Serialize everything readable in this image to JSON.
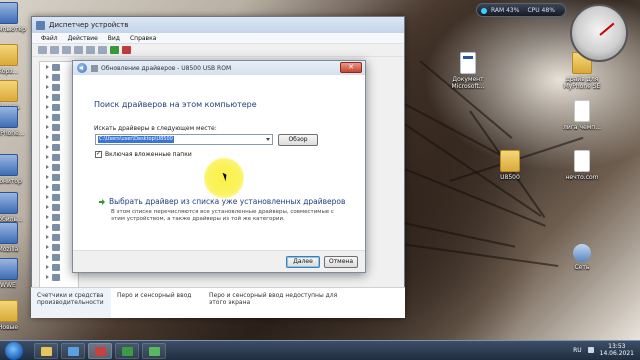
{
  "desktop": {
    "left_icons": [
      {
        "label": "Компьютер",
        "kind": "app"
      },
      {
        "label": "Корз...",
        "kind": "folder"
      },
      {
        "label": "Панель",
        "kind": "folder"
      },
      {
        "label": "MyPhone...",
        "kind": "app"
      },
      {
        "label": "Монитор",
        "kind": "app"
      },
      {
        "label": "Мобиль...",
        "kind": "app"
      },
      {
        "label": "Mozilla",
        "kind": "app"
      },
      {
        "label": "WWE",
        "kind": "app"
      },
      {
        "label": "Новые",
        "kind": "folder"
      }
    ],
    "right_icons": [
      {
        "label": "Документ Microsoft...",
        "kind": "word"
      },
      {
        "label": "драйв для MyPhone SE",
        "kind": "folder"
      },
      {
        "label": "лига чемп...",
        "kind": "doc"
      },
      {
        "label": "U8500",
        "kind": "folder"
      },
      {
        "label": "нечто.com",
        "kind": "doc"
      },
      {
        "label": "Сеть",
        "kind": "net"
      }
    ]
  },
  "gadgets": {
    "ram": "RAM 43%",
    "cpu": "CPU 48%"
  },
  "device_manager": {
    "title": "Диспетчер устройств",
    "menu": [
      "Файл",
      "Действие",
      "Вид",
      "Справка"
    ]
  },
  "control_panel_row": {
    "col1": "Счетчики и средства производительности",
    "col2": "Перо и сенсорный ввод",
    "col3": "Перо и сенсорный ввод недоступны для этого экрана"
  },
  "dialog": {
    "title": "Обновление драйверов - U8500 USB ROM",
    "close_label": "✕",
    "heading": "Поиск драйверов на этом компьютере",
    "path_label": "Искать драйверы в следующем месте:",
    "path_value": "C:\\Users\\user\\Desktop\\U8500",
    "browse_label": "Обзор",
    "include_subfolders_label": "Включая вложенные папки",
    "include_subfolders_checked": true,
    "pick_title": "Выбрать драйвер из списка уже установленных драйверов",
    "pick_description": "В этом списке перечисляются все установленные драйверы, совместимые с этим устройством, а также драйверы из той же категории.",
    "next_label": "Далее",
    "cancel_label": "Отмена"
  },
  "taskbar": {
    "lang": "RU",
    "time": "13:53",
    "date": "14.06.2021"
  },
  "colors": {
    "heading": "#1e3f82",
    "selection": "#3875d7",
    "taskbar": "#1f2d40"
  }
}
